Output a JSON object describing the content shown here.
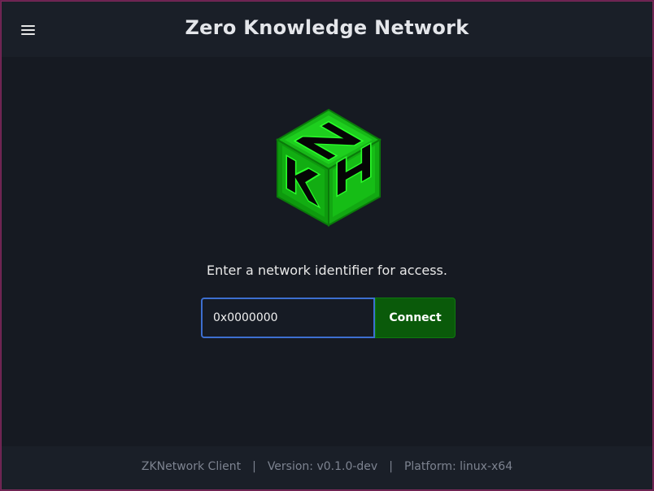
{
  "header": {
    "title": "Zero Knowledge Network",
    "menu_icon": "hamburger-menu-icon"
  },
  "logo": {
    "icon": "zkn-cube-logo",
    "colors": {
      "primary": "#1fcf1f",
      "dark": "#0c8a0c",
      "letters": "#050505"
    }
  },
  "main": {
    "prompt": "Enter a network identifier for access.",
    "input_value": "0x0000000",
    "connect_label": "Connect"
  },
  "footer": {
    "client": "ZKNetwork Client",
    "separator": "|",
    "version": "Version: v0.1.0-dev",
    "platform": "Platform: linux-x64"
  },
  "colors": {
    "background": "#161a22",
    "accent_button": "#0a5a0a",
    "focus_border": "#3d6fd0"
  }
}
